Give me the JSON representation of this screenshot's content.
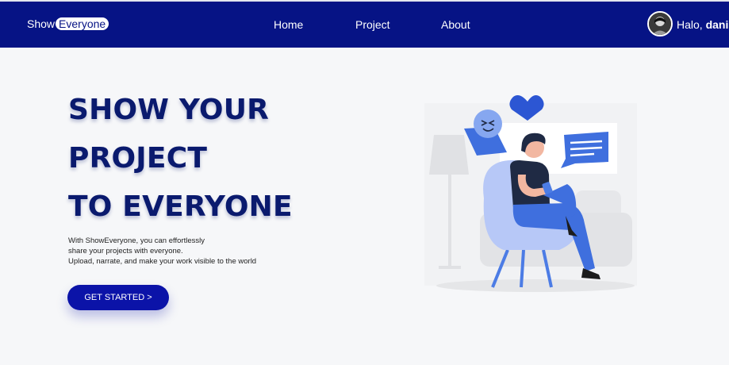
{
  "brand": {
    "part1": "Show",
    "part2": "Everyone"
  },
  "nav": {
    "home": "Home",
    "project": "Project",
    "about": "About"
  },
  "user": {
    "greeting": "Halo,",
    "name": "dani"
  },
  "hero": {
    "title_lines": [
      "SHOW YOUR",
      "PROJECT",
      "TO EVERYONE"
    ],
    "description_lines": [
      "With ShowEveryone, you can effortlessly",
      "share your projects with everyone.",
      "Upload, narrate, and make your work visible to the world"
    ],
    "cta_label": "GET STARTED >"
  },
  "colors": {
    "navbar": "#061385",
    "title": "#0a1a6e",
    "cta": "#0b13a8",
    "illustration_blue": "#4c7ce5"
  }
}
